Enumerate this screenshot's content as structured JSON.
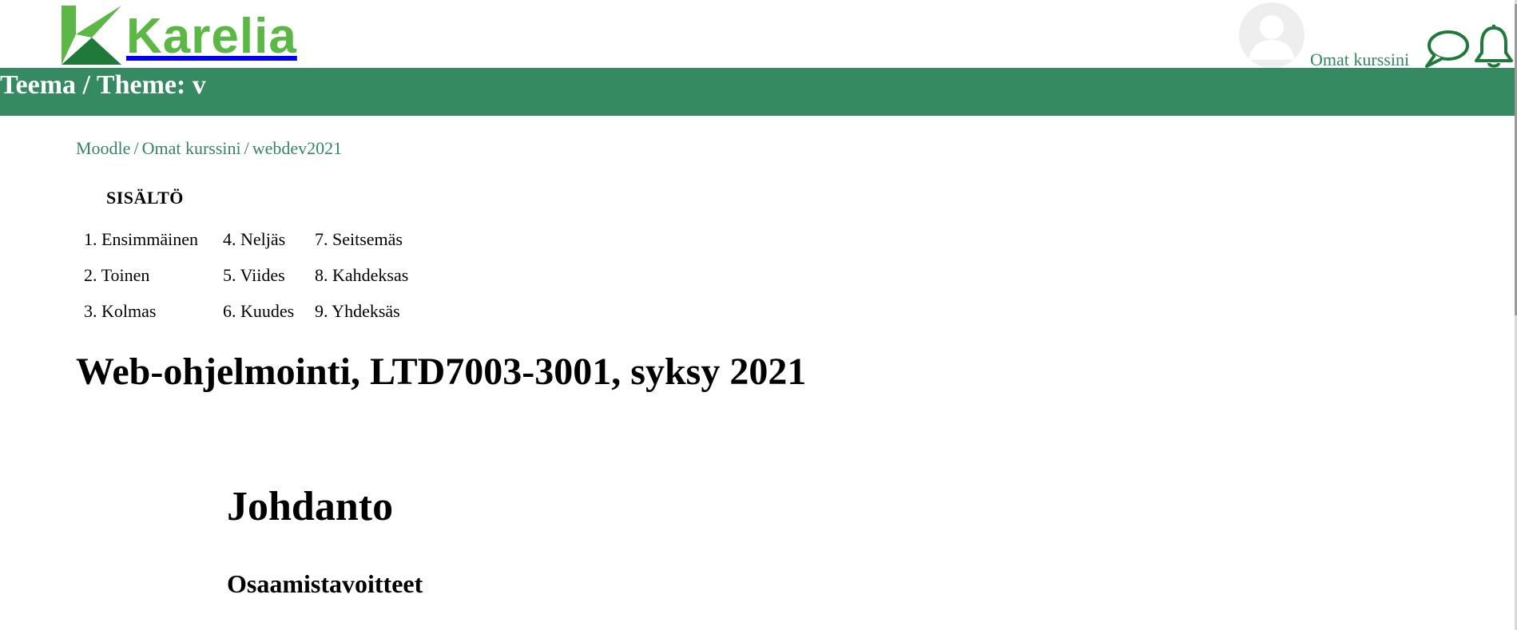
{
  "brand": {
    "name": "Karelia",
    "color": "#5cb845"
  },
  "header": {
    "user_link": "Omat kurssini",
    "icons": [
      "avatar",
      "message-icon",
      "bell-icon"
    ]
  },
  "theme": {
    "title": "Teema / Theme: v",
    "color": "#358a62"
  },
  "breadcrumb": {
    "items": [
      "Moodle",
      "Omat kurssini",
      "webdev2021"
    ],
    "separator": "/"
  },
  "toc": {
    "title": "SISÄLTÖ",
    "items": [
      "1. Ensimmäinen",
      "2. Toinen",
      "3. Kolmas",
      "4. Neljäs",
      "5. Viides",
      "6. Kuudes",
      "7. Seitsemäs",
      "8. Kahdeksas",
      "9. Yhdeksäs"
    ]
  },
  "course": {
    "title": "Web-ohjelmointi, LTD7003-3001, syksy 2021"
  },
  "section": {
    "title": "Johdanto",
    "subtitle": "Osaamistavoitteet"
  }
}
